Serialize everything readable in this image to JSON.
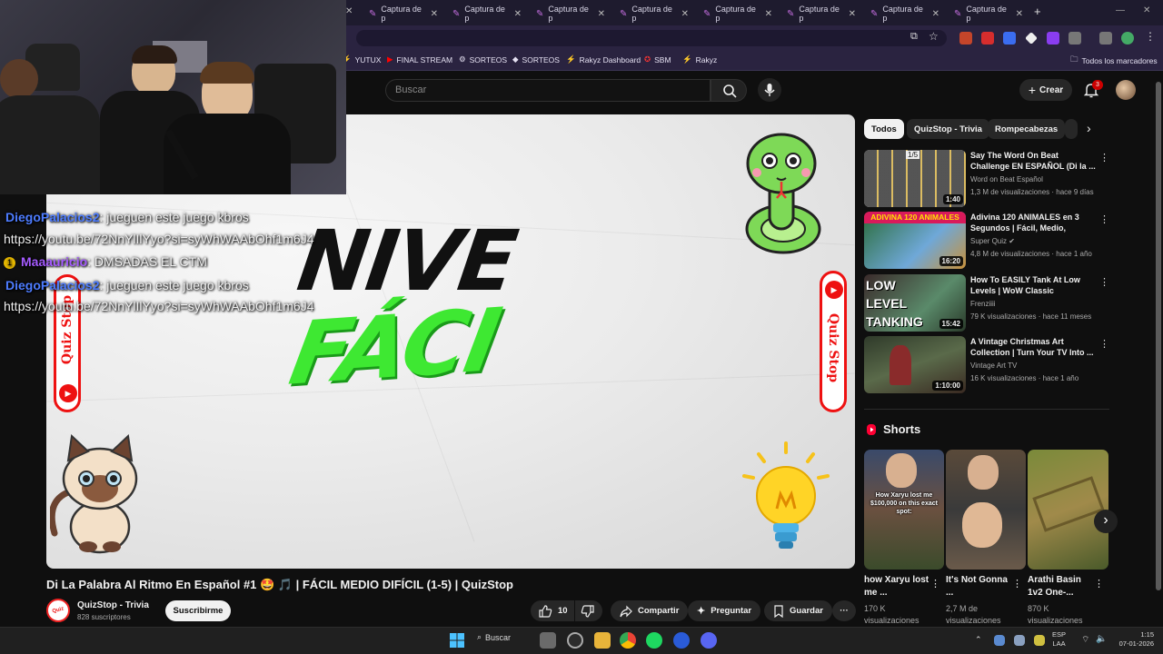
{
  "browser": {
    "tabs": [
      "Captura de p",
      "Captura de p",
      "Captura de p",
      "Captura de p",
      "Captura de p",
      "Captura de p",
      "Captura de p",
      "Captura de p"
    ],
    "new_tab": "+",
    "bookmarks": [
      "YUTUX",
      "FINAL STREAM",
      "SORTEOS",
      "SORTEOS",
      "Rakyz Dashboard",
      "SBM",
      "Rakyz"
    ],
    "all_bookmarks": "Todos los marcadores"
  },
  "header": {
    "search_placeholder": "Buscar",
    "create_label": "Crear",
    "notif_count": "3"
  },
  "overlay_chat": [
    {
      "user": "DiegoPalacios2",
      "msg": ": jueguen este juego kbros",
      "color": "blue"
    },
    {
      "user": "",
      "msg": "https://youtu.be/72NnYlIlYyo?si=syWhWAAbOhf1m6J4",
      "color": "none"
    },
    {
      "user": "Maaauricio",
      "msg": ": DMSADAS EL CTM",
      "color": "purple"
    },
    {
      "user": "DiegoPalacios2",
      "msg": ": jueguen este juego kbros",
      "color": "blue"
    },
    {
      "user": "",
      "msg": "https://youtu.be/72NnYlIlYyo?si=syWhWAAbOhf1m6J4",
      "color": "none"
    }
  ],
  "player": {
    "text_line1": "NIVE",
    "text_line2": "FÁCI",
    "brand": "Quiz Stop"
  },
  "video": {
    "title": "Di La Palabra Al Ritmo En Español #1 🤩 🎵 | FÁCIL MEDIO DIFÍCIL (1-5) | QuizStop",
    "channel": "QuizStop - Trivia",
    "subs": "828 suscriptores",
    "subscribe": "Suscribirme",
    "likes": "10",
    "share": "Compartir",
    "ask": "Preguntar",
    "save": "Guardar",
    "more": "···"
  },
  "chips": [
    "Todos",
    "QuizStop - Trivia",
    "Rompecabezas"
  ],
  "recommendations": [
    {
      "title": "Say The Word On Beat Challenge EN ESPAÑOL (Di la ...",
      "channel": "Word on Beat Español",
      "meta": "1,3 M de visualizaciones · hace 9 días",
      "duration": "1:40",
      "thumb_label": "1/5"
    },
    {
      "title": "Adivina 120 ANIMALES en 3 Segundos | Fácil, Medio, Difícil...",
      "channel": "Super Quiz",
      "meta": "4,8 M de visualizaciones · hace 1 año",
      "duration": "16:20",
      "thumb_label": "ADIVINA 120 ANIMALES"
    },
    {
      "title": "How To EASILY Tank At Low Levels | WoW Classic",
      "channel": "Frenziiii",
      "meta": "79 K visualizaciones · hace 11 meses",
      "duration": "15:42",
      "thumb_label": "LOW LEVEL TANKING EXPLAINED"
    },
    {
      "title": "A Vintage Christmas Art Collection | Turn Your TV Into ...",
      "channel": "Vintage Art TV",
      "meta": "16 K visualizaciones · hace 1 año",
      "duration": "1:10:00",
      "thumb_label": ""
    }
  ],
  "shorts": {
    "heading": "Shorts",
    "items": [
      {
        "title": "how Xaryu lost me ...",
        "views": "170 K visualizaciones",
        "caption": "How Xaryu lost me $100,000 on this exact spot:"
      },
      {
        "title": "It's Not Gonna ...",
        "views": "2,7 M de visualizaciones",
        "caption": ""
      },
      {
        "title": "Arathi Basin 1v2 One-...",
        "views": "870 K visualizaciones",
        "caption": ""
      }
    ]
  },
  "taskbar": {
    "search": "Buscar",
    "lang1": "ESP",
    "lang2": "LAA",
    "time": "1:15",
    "date": "07-01-2026"
  },
  "colors": {
    "accent_red": "#cc0000",
    "youtube_bg": "#0f0f0f",
    "green_text": "#3ee832"
  }
}
